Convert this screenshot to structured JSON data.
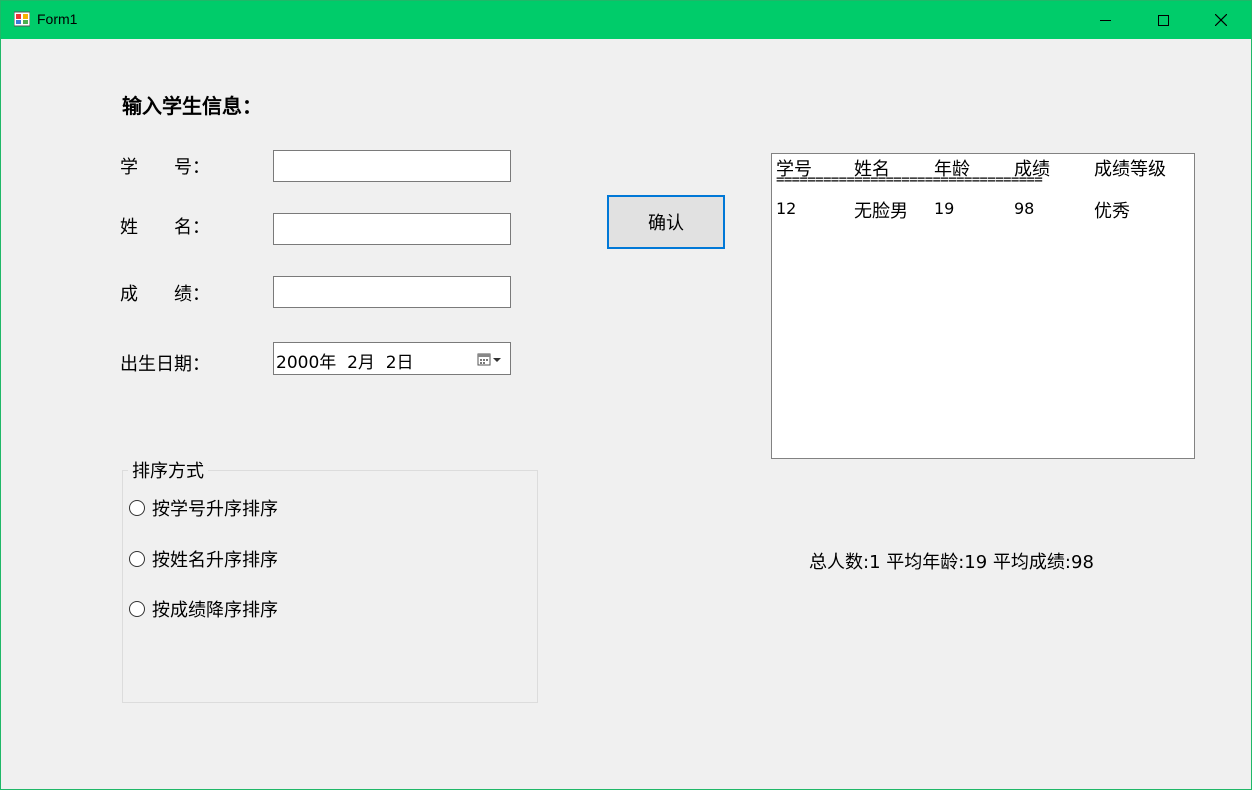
{
  "window": {
    "title": "Form1",
    "accent": "#00cc6a"
  },
  "form": {
    "heading": "输入学生信息：",
    "fields": {
      "id_label": "学　　号：",
      "id_value": "",
      "name_label": "姓　　名：",
      "name_value": "",
      "score_label": "成　　绩：",
      "score_value": "",
      "birth_label": "出生日期：",
      "birth_value": "2000年  2月  2日"
    },
    "confirm_label": "确认"
  },
  "sort_group": {
    "title": "排序方式",
    "options": [
      "按学号升序排序",
      "按姓名升序排序",
      "按成绩降序排序"
    ]
  },
  "listbox": {
    "headers": [
      "学号",
      "姓名",
      "年龄",
      "成绩",
      "成绩等级"
    ],
    "separator": "==================================",
    "rows": [
      [
        "12",
        "无脸男",
        "19",
        "98",
        "优秀"
      ]
    ]
  },
  "summary": "总人数:1 平均年龄:19 平均成绩:98",
  "icons": [
    "app-icon",
    "minimize-icon",
    "maximize-icon",
    "close-icon",
    "calendar-icon"
  ]
}
